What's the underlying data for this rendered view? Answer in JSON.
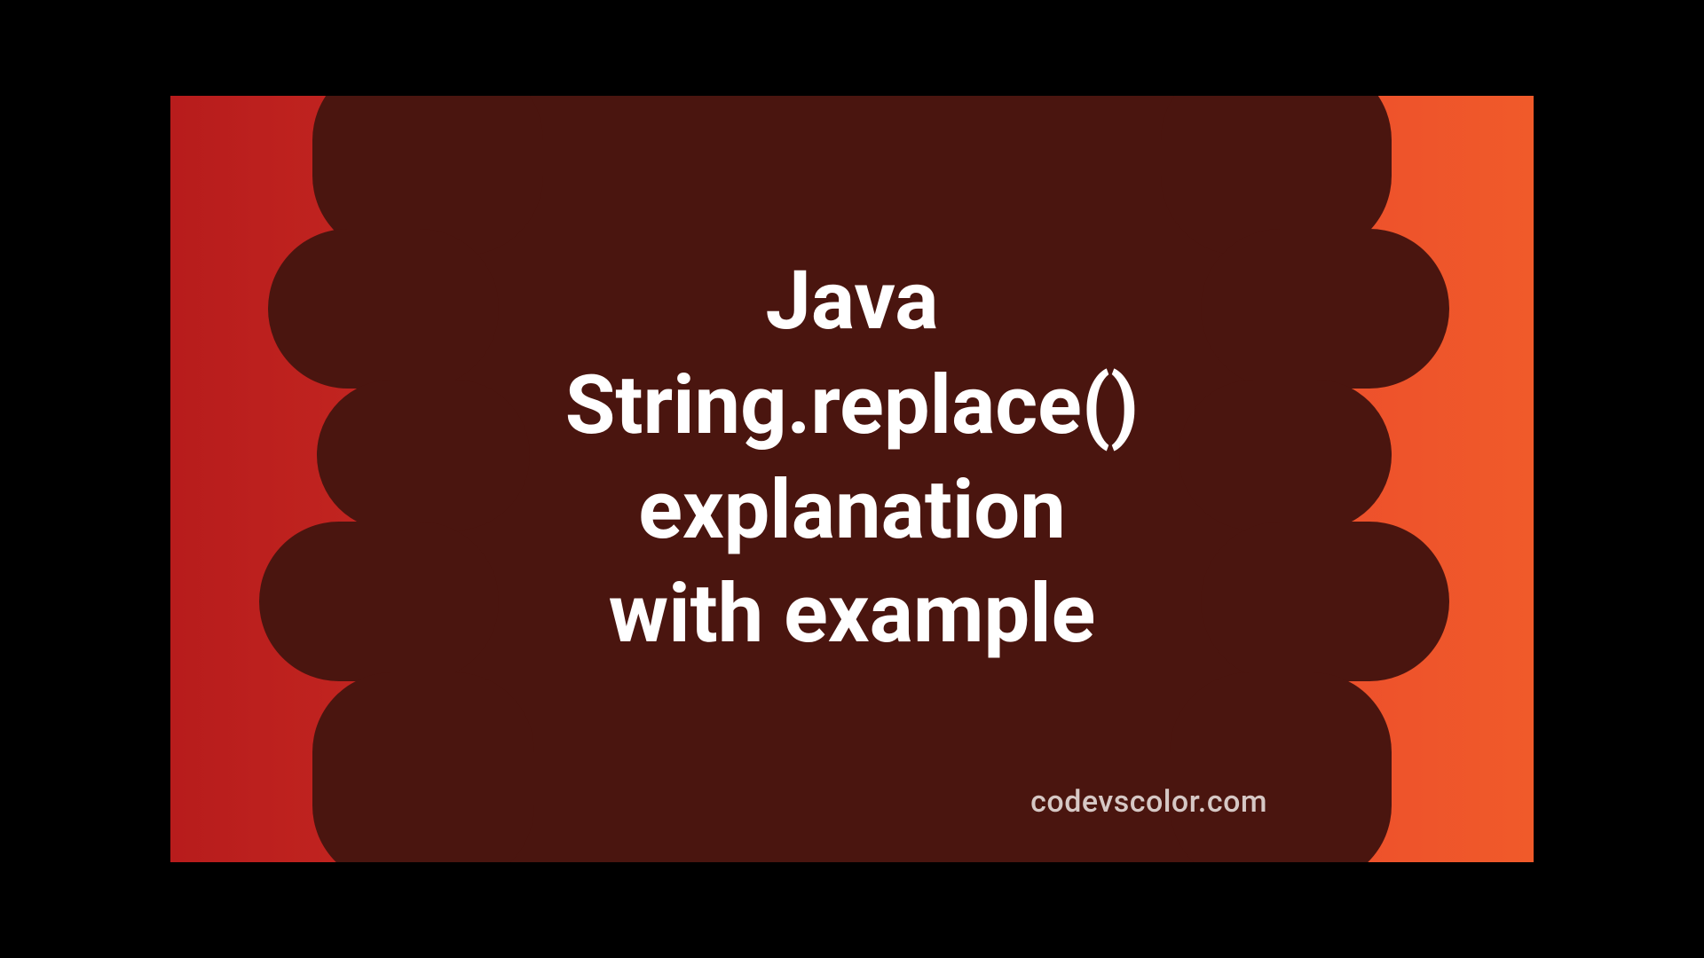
{
  "title_lines": {
    "l1": "Java",
    "l2": "String.replace()",
    "l3": "explanation",
    "l4": "with example"
  },
  "watermark": "codevscolor.com",
  "colors": {
    "gradient_left": "#b71c1c",
    "gradient_right": "#f05a2a",
    "blob": "#4a150f",
    "text": "#ffffff"
  }
}
